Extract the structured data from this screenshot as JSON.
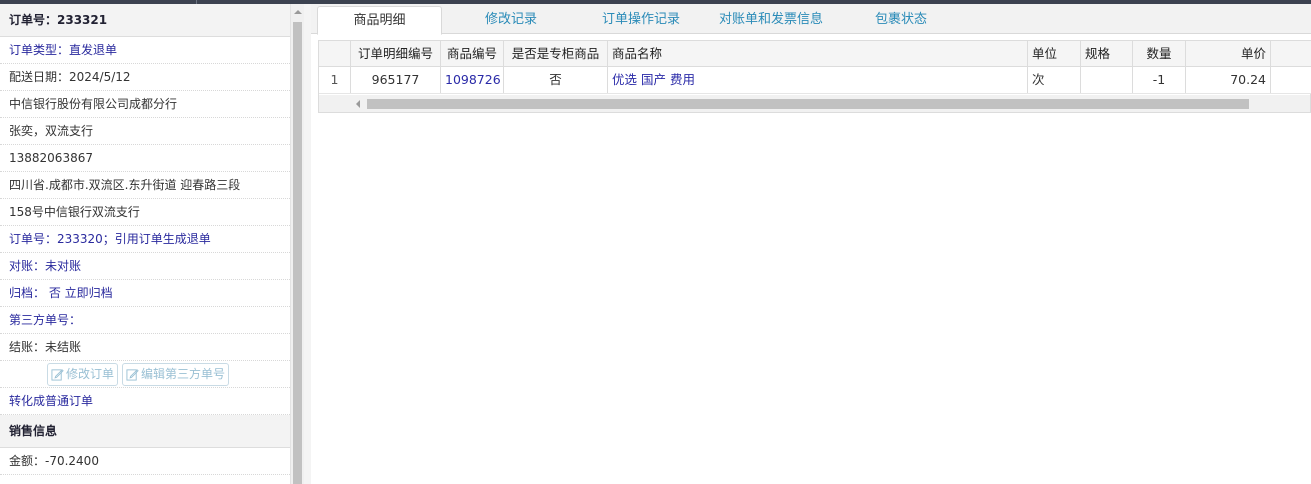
{
  "order": {
    "header": "订单号：233321",
    "type": "订单类型：直发退单",
    "delivery_date": "配送日期：2024/5/12",
    "company": "中信银行股份有限公司成都分行",
    "contact": "张奕，双流支行",
    "phone": "13882063867",
    "address_line1": "四川省.成都市.双流区.东升街道 迎春路三段",
    "address_line2": "158号中信银行双流支行",
    "ref_order": "订单号：233320；引用订单生成退单",
    "reconcile": "对账：未对账",
    "archive": "归档： 否 立即归档",
    "third_party_no": "第三方单号：",
    "settlement": "结账：未结账",
    "btn_edit_order": "修改订单",
    "btn_edit_third": "编辑第三方单号",
    "convert": "转化成普通订单"
  },
  "sales": {
    "header": "销售信息",
    "amount": "金额：-70.2400"
  },
  "tabs": [
    {
      "label": "商品明细",
      "active": true
    },
    {
      "label": "修改记录",
      "active": false
    },
    {
      "label": "订单操作记录",
      "active": false
    },
    {
      "label": "对账单和发票信息",
      "active": false
    },
    {
      "label": "包裹状态",
      "active": false
    }
  ],
  "table": {
    "columns": [
      "订单明细编号",
      "商品编号",
      "是否是专柜商品",
      "商品名称",
      "单位",
      "规格",
      "数量",
      "单价"
    ],
    "rows": [
      {
        "index": "1",
        "detail_id": "965177",
        "product_id": "1098726",
        "is_counter": "否",
        "name": "优选 国产 费用",
        "unit": "次",
        "spec": "",
        "qty": "-1",
        "price": "70.24"
      }
    ]
  },
  "icons": {
    "edit": "edit-icon"
  },
  "colors": {
    "link": "#2a2aa8",
    "tab_text": "#2a8bb8",
    "disabled_button": "#9ac0d4"
  }
}
